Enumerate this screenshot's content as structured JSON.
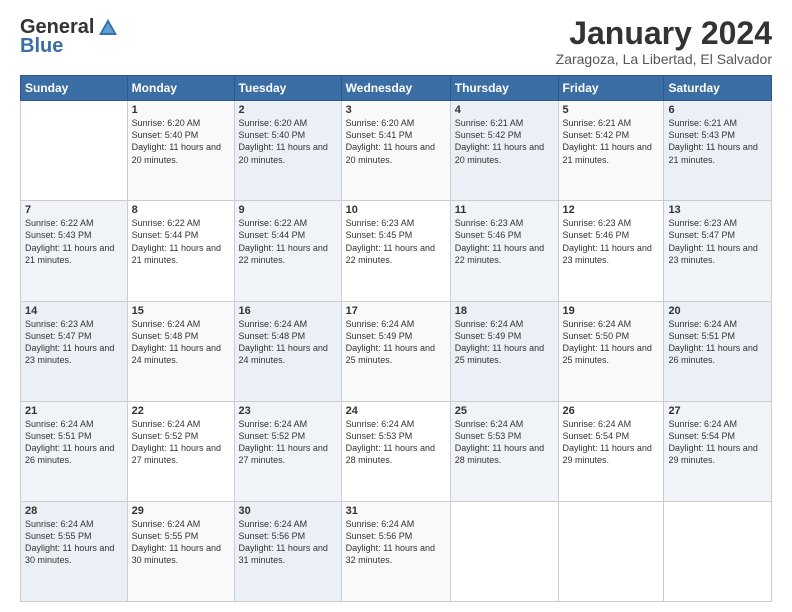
{
  "header": {
    "logo": {
      "general": "General",
      "blue": "Blue"
    },
    "title": "January 2024",
    "subtitle": "Zaragoza, La Libertad, El Salvador"
  },
  "calendar": {
    "days_of_week": [
      "Sunday",
      "Monday",
      "Tuesday",
      "Wednesday",
      "Thursday",
      "Friday",
      "Saturday"
    ],
    "weeks": [
      [
        {
          "day": "",
          "sunrise": "",
          "sunset": "",
          "daylight": ""
        },
        {
          "day": "1",
          "sunrise": "Sunrise: 6:20 AM",
          "sunset": "Sunset: 5:40 PM",
          "daylight": "Daylight: 11 hours and 20 minutes."
        },
        {
          "day": "2",
          "sunrise": "Sunrise: 6:20 AM",
          "sunset": "Sunset: 5:40 PM",
          "daylight": "Daylight: 11 hours and 20 minutes."
        },
        {
          "day": "3",
          "sunrise": "Sunrise: 6:20 AM",
          "sunset": "Sunset: 5:41 PM",
          "daylight": "Daylight: 11 hours and 20 minutes."
        },
        {
          "day": "4",
          "sunrise": "Sunrise: 6:21 AM",
          "sunset": "Sunset: 5:42 PM",
          "daylight": "Daylight: 11 hours and 20 minutes."
        },
        {
          "day": "5",
          "sunrise": "Sunrise: 6:21 AM",
          "sunset": "Sunset: 5:42 PM",
          "daylight": "Daylight: 11 hours and 21 minutes."
        },
        {
          "day": "6",
          "sunrise": "Sunrise: 6:21 AM",
          "sunset": "Sunset: 5:43 PM",
          "daylight": "Daylight: 11 hours and 21 minutes."
        }
      ],
      [
        {
          "day": "7",
          "sunrise": "Sunrise: 6:22 AM",
          "sunset": "Sunset: 5:43 PM",
          "daylight": "Daylight: 11 hours and 21 minutes."
        },
        {
          "day": "8",
          "sunrise": "Sunrise: 6:22 AM",
          "sunset": "Sunset: 5:44 PM",
          "daylight": "Daylight: 11 hours and 21 minutes."
        },
        {
          "day": "9",
          "sunrise": "Sunrise: 6:22 AM",
          "sunset": "Sunset: 5:44 PM",
          "daylight": "Daylight: 11 hours and 22 minutes."
        },
        {
          "day": "10",
          "sunrise": "Sunrise: 6:23 AM",
          "sunset": "Sunset: 5:45 PM",
          "daylight": "Daylight: 11 hours and 22 minutes."
        },
        {
          "day": "11",
          "sunrise": "Sunrise: 6:23 AM",
          "sunset": "Sunset: 5:46 PM",
          "daylight": "Daylight: 11 hours and 22 minutes."
        },
        {
          "day": "12",
          "sunrise": "Sunrise: 6:23 AM",
          "sunset": "Sunset: 5:46 PM",
          "daylight": "Daylight: 11 hours and 23 minutes."
        },
        {
          "day": "13",
          "sunrise": "Sunrise: 6:23 AM",
          "sunset": "Sunset: 5:47 PM",
          "daylight": "Daylight: 11 hours and 23 minutes."
        }
      ],
      [
        {
          "day": "14",
          "sunrise": "Sunrise: 6:23 AM",
          "sunset": "Sunset: 5:47 PM",
          "daylight": "Daylight: 11 hours and 23 minutes."
        },
        {
          "day": "15",
          "sunrise": "Sunrise: 6:24 AM",
          "sunset": "Sunset: 5:48 PM",
          "daylight": "Daylight: 11 hours and 24 minutes."
        },
        {
          "day": "16",
          "sunrise": "Sunrise: 6:24 AM",
          "sunset": "Sunset: 5:48 PM",
          "daylight": "Daylight: 11 hours and 24 minutes."
        },
        {
          "day": "17",
          "sunrise": "Sunrise: 6:24 AM",
          "sunset": "Sunset: 5:49 PM",
          "daylight": "Daylight: 11 hours and 25 minutes."
        },
        {
          "day": "18",
          "sunrise": "Sunrise: 6:24 AM",
          "sunset": "Sunset: 5:49 PM",
          "daylight": "Daylight: 11 hours and 25 minutes."
        },
        {
          "day": "19",
          "sunrise": "Sunrise: 6:24 AM",
          "sunset": "Sunset: 5:50 PM",
          "daylight": "Daylight: 11 hours and 25 minutes."
        },
        {
          "day": "20",
          "sunrise": "Sunrise: 6:24 AM",
          "sunset": "Sunset: 5:51 PM",
          "daylight": "Daylight: 11 hours and 26 minutes."
        }
      ],
      [
        {
          "day": "21",
          "sunrise": "Sunrise: 6:24 AM",
          "sunset": "Sunset: 5:51 PM",
          "daylight": "Daylight: 11 hours and 26 minutes."
        },
        {
          "day": "22",
          "sunrise": "Sunrise: 6:24 AM",
          "sunset": "Sunset: 5:52 PM",
          "daylight": "Daylight: 11 hours and 27 minutes."
        },
        {
          "day": "23",
          "sunrise": "Sunrise: 6:24 AM",
          "sunset": "Sunset: 5:52 PM",
          "daylight": "Daylight: 11 hours and 27 minutes."
        },
        {
          "day": "24",
          "sunrise": "Sunrise: 6:24 AM",
          "sunset": "Sunset: 5:53 PM",
          "daylight": "Daylight: 11 hours and 28 minutes."
        },
        {
          "day": "25",
          "sunrise": "Sunrise: 6:24 AM",
          "sunset": "Sunset: 5:53 PM",
          "daylight": "Daylight: 11 hours and 28 minutes."
        },
        {
          "day": "26",
          "sunrise": "Sunrise: 6:24 AM",
          "sunset": "Sunset: 5:54 PM",
          "daylight": "Daylight: 11 hours and 29 minutes."
        },
        {
          "day": "27",
          "sunrise": "Sunrise: 6:24 AM",
          "sunset": "Sunset: 5:54 PM",
          "daylight": "Daylight: 11 hours and 29 minutes."
        }
      ],
      [
        {
          "day": "28",
          "sunrise": "Sunrise: 6:24 AM",
          "sunset": "Sunset: 5:55 PM",
          "daylight": "Daylight: 11 hours and 30 minutes."
        },
        {
          "day": "29",
          "sunrise": "Sunrise: 6:24 AM",
          "sunset": "Sunset: 5:55 PM",
          "daylight": "Daylight: 11 hours and 30 minutes."
        },
        {
          "day": "30",
          "sunrise": "Sunrise: 6:24 AM",
          "sunset": "Sunset: 5:56 PM",
          "daylight": "Daylight: 11 hours and 31 minutes."
        },
        {
          "day": "31",
          "sunrise": "Sunrise: 6:24 AM",
          "sunset": "Sunset: 5:56 PM",
          "daylight": "Daylight: 11 hours and 32 minutes."
        },
        {
          "day": "",
          "sunrise": "",
          "sunset": "",
          "daylight": ""
        },
        {
          "day": "",
          "sunrise": "",
          "sunset": "",
          "daylight": ""
        },
        {
          "day": "",
          "sunrise": "",
          "sunset": "",
          "daylight": ""
        }
      ]
    ]
  }
}
